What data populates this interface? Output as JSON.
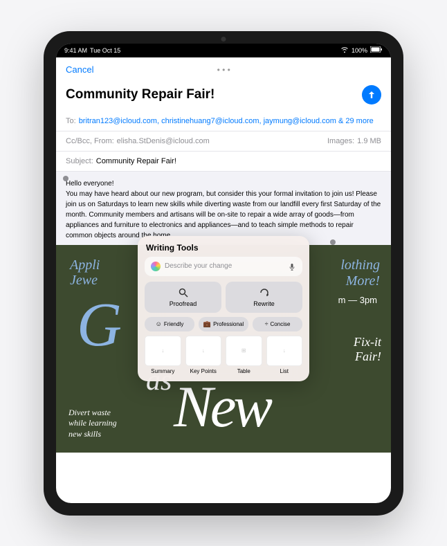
{
  "status": {
    "time": "9:41 AM",
    "date": "Tue Oct 15",
    "wifi": "wifi",
    "battery": "100%"
  },
  "nav": {
    "cancel": "Cancel",
    "title": "Community Repair Fair!"
  },
  "fields": {
    "to_label": "To:",
    "recipients": "britran123@icloud.com, christinehuang7@icloud.com, jaymung@icloud.com & 29 more",
    "cc_label": "Cc/Bcc, From:",
    "from": "elisha.StDenis@icloud.com",
    "images_label": "Images:",
    "images_size": "1.9 MB",
    "subject_label": "Subject:",
    "subject": "Community Repair Fair!"
  },
  "body": {
    "greeting": "Hello everyone!",
    "text": "You may have heard about our new program, but consider this your formal invitation to join us! Please join us on Saturdays to learn new skills while diverting waste from our landfill every first Saturday of the month. Community members and artisans will be on-site to repair a wide array of goods—from appliances and furniture to electronics and appliances—and to teach simple methods to repair common objects around the home."
  },
  "poster": {
    "top_left_1": "Appli",
    "top_left_2": "Jewe",
    "top_right_1": "lothing",
    "top_right_2": "More!",
    "time": "m — 3pm",
    "big": "G",
    "as": "as",
    "new": "New",
    "fixit_1": "Fix-it",
    "fixit_2": "Fair!",
    "divert_1": "Divert waste",
    "divert_2": "while learning",
    "divert_3": "new skills"
  },
  "wt": {
    "title": "Writing Tools",
    "placeholder": "Describe your change",
    "proofread": "Proofread",
    "rewrite": "Rewrite",
    "friendly": "Friendly",
    "professional": "Professional",
    "concise": "Concise",
    "summary": "Summary",
    "keypoints": "Key Points",
    "table": "Table",
    "list": "List"
  }
}
